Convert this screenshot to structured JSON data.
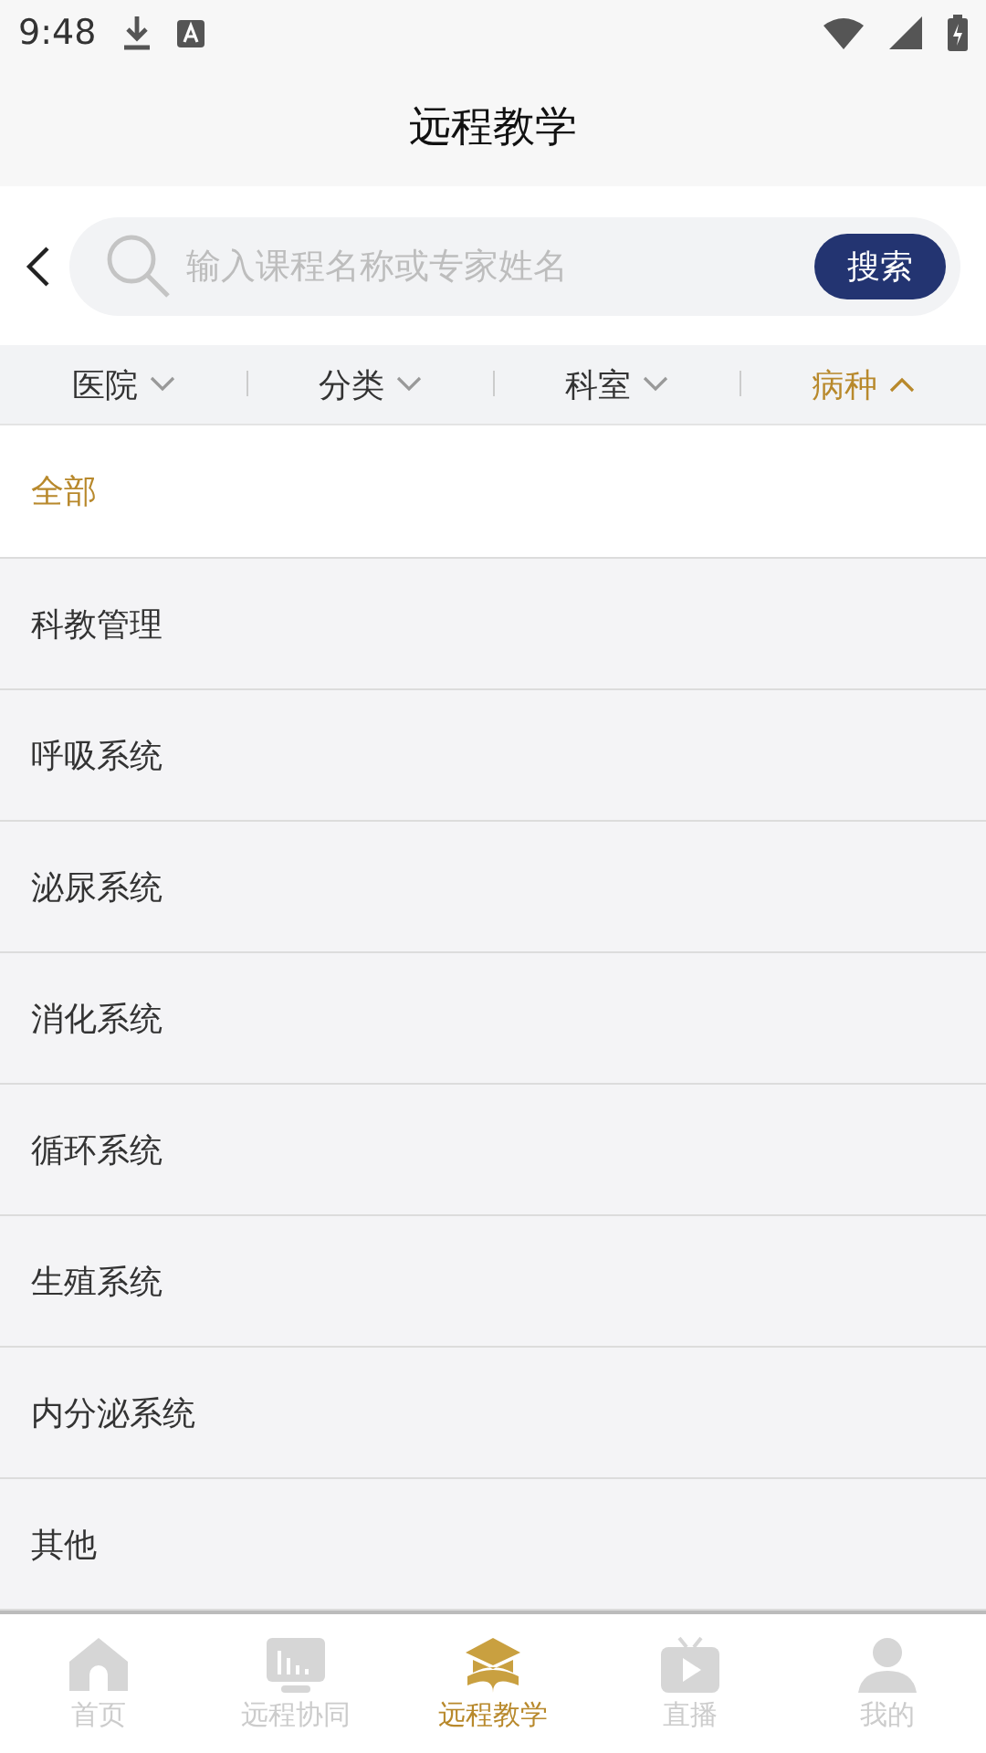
{
  "status_bar": {
    "time": "9:48"
  },
  "header": {
    "title": "远程教学"
  },
  "search": {
    "placeholder": "输入课程名称或专家姓名",
    "button": "搜索"
  },
  "filters": [
    {
      "label": "医院",
      "selected": false
    },
    {
      "label": "分类",
      "selected": false
    },
    {
      "label": "科室",
      "selected": false
    },
    {
      "label": "病种",
      "selected": true
    }
  ],
  "options": [
    {
      "label": "全部",
      "selected": true
    },
    {
      "label": "科教管理",
      "selected": false
    },
    {
      "label": "呼吸系统",
      "selected": false
    },
    {
      "label": "泌尿系统",
      "selected": false
    },
    {
      "label": "消化系统",
      "selected": false
    },
    {
      "label": "循环系统",
      "selected": false
    },
    {
      "label": "生殖系统",
      "selected": false
    },
    {
      "label": "内分泌系统",
      "selected": false
    },
    {
      "label": "其他",
      "selected": false
    }
  ],
  "bottom_nav": [
    {
      "label": "首页",
      "kind": "home",
      "selected": false
    },
    {
      "label": "远程协同",
      "kind": "monitor",
      "selected": false
    },
    {
      "label": "远程教学",
      "kind": "cap",
      "selected": true
    },
    {
      "label": "直播",
      "kind": "tv",
      "selected": false
    },
    {
      "label": "我的",
      "kind": "person",
      "selected": false
    }
  ]
}
